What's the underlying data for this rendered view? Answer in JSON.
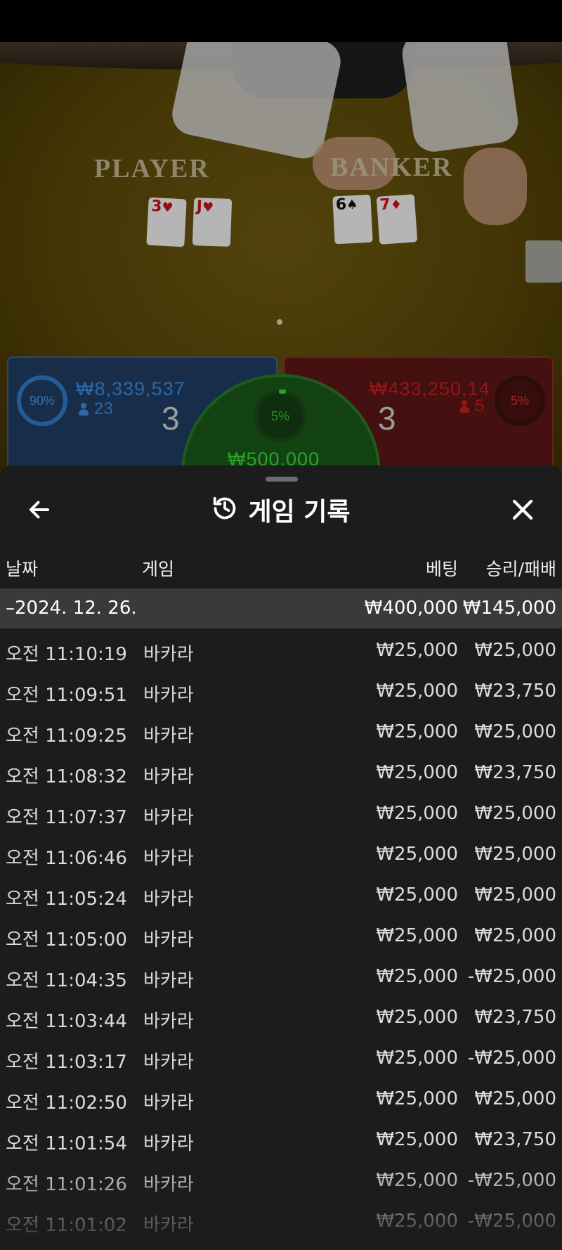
{
  "video": {
    "player_label": "PLAYER",
    "banker_label": "BANKER",
    "player_cards": [
      {
        "rank": "3",
        "suit": "♥",
        "color": "red"
      },
      {
        "rank": "J",
        "suit": "♥",
        "color": "red"
      }
    ],
    "banker_cards": [
      {
        "rank": "6",
        "suit": "♠",
        "color": "black"
      },
      {
        "rank": "7",
        "suit": "♦",
        "color": "red"
      }
    ],
    "player_panel": {
      "percent": "90%",
      "amount": "₩8,339,537",
      "users": "23",
      "score": "3"
    },
    "banker_panel": {
      "percent": "5%",
      "amount": "₩433,250,14",
      "users": "5",
      "score": "3"
    },
    "tie_panel": {
      "percent": "5%",
      "amount": "₩500,000"
    }
  },
  "sheet": {
    "title": "게임 기록",
    "columns": {
      "date": "날짜",
      "game": "게임",
      "bet": "베팅",
      "result": "승리/패배"
    },
    "day": {
      "label": "–2024. 12. 26.",
      "bet_total": "₩400,000",
      "result_total": "₩145,000"
    },
    "rows": [
      {
        "time": "오전 11:10:19",
        "game": "바카라",
        "bet": "₩25,000",
        "result": "₩25,000"
      },
      {
        "time": "오전 11:09:51",
        "game": "바카라",
        "bet": "₩25,000",
        "result": "₩23,750"
      },
      {
        "time": "오전 11:09:25",
        "game": "바카라",
        "bet": "₩25,000",
        "result": "₩25,000"
      },
      {
        "time": "오전 11:08:32",
        "game": "바카라",
        "bet": "₩25,000",
        "result": "₩23,750"
      },
      {
        "time": "오전 11:07:37",
        "game": "바카라",
        "bet": "₩25,000",
        "result": "₩25,000"
      },
      {
        "time": "오전 11:06:46",
        "game": "바카라",
        "bet": "₩25,000",
        "result": "₩25,000"
      },
      {
        "time": "오전 11:05:24",
        "game": "바카라",
        "bet": "₩25,000",
        "result": "₩25,000"
      },
      {
        "time": "오전 11:05:00",
        "game": "바카라",
        "bet": "₩25,000",
        "result": "₩25,000"
      },
      {
        "time": "오전 11:04:35",
        "game": "바카라",
        "bet": "₩25,000",
        "result": "-₩25,000"
      },
      {
        "time": "오전 11:03:44",
        "game": "바카라",
        "bet": "₩25,000",
        "result": "₩23,750"
      },
      {
        "time": "오전 11:03:17",
        "game": "바카라",
        "bet": "₩25,000",
        "result": "-₩25,000"
      },
      {
        "time": "오전 11:02:50",
        "game": "바카라",
        "bet": "₩25,000",
        "result": "₩25,000"
      },
      {
        "time": "오전 11:01:54",
        "game": "바카라",
        "bet": "₩25,000",
        "result": "₩23,750"
      },
      {
        "time": "오전 11:01:26",
        "game": "바카라",
        "bet": "₩25,000",
        "result": "-₩25,000"
      },
      {
        "time": "오전 11:01:02",
        "game": "바카라",
        "bet": "₩25,000",
        "result": "-₩25,000"
      }
    ]
  }
}
